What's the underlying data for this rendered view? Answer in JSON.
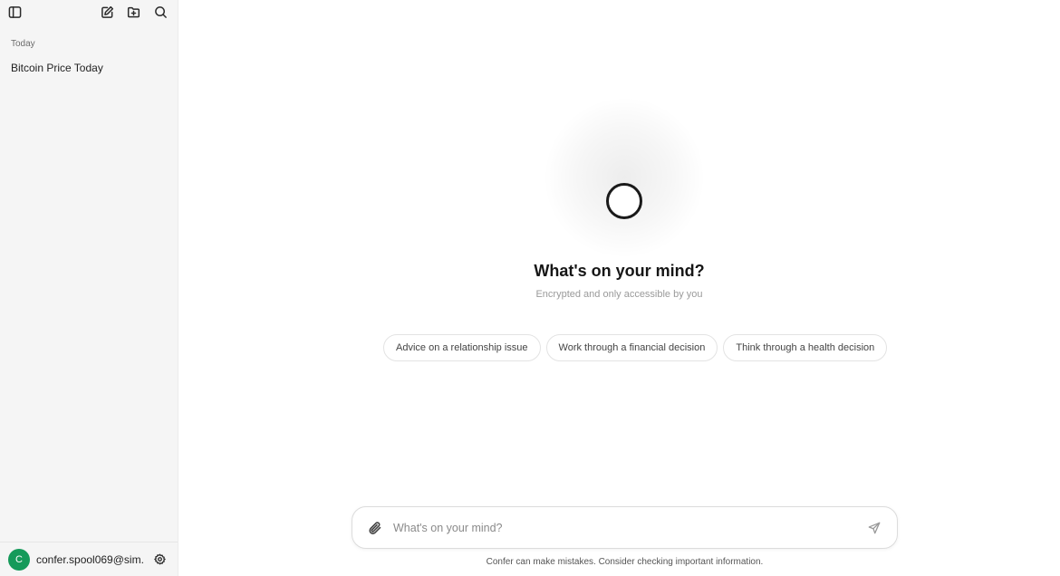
{
  "sidebar": {
    "toggle_icon": "sidebar-toggle-icon",
    "new_chat_icon": "edit-icon",
    "new_folder_icon": "folder-plus-icon",
    "search_icon": "search-icon",
    "section_label": "Today",
    "chats": [
      {
        "title": "Bitcoin Price Today"
      }
    ],
    "user": {
      "avatar_letter": "C",
      "avatar_color": "#159a5a",
      "email": "confer.spool069@sim..."
    },
    "settings_icon": "gear-icon"
  },
  "main": {
    "heading": "What's on your mind?",
    "subheading": "Encrypted and only accessible by you",
    "suggestions": [
      "Advice on a relationship issue",
      "Work through a financial decision",
      "Think through a health decision"
    ],
    "composer": {
      "placeholder": "What's on your mind?",
      "attach_icon": "paperclip-icon",
      "send_icon": "send-icon"
    },
    "disclaimer": "Confer can make mistakes. Consider checking important information."
  }
}
